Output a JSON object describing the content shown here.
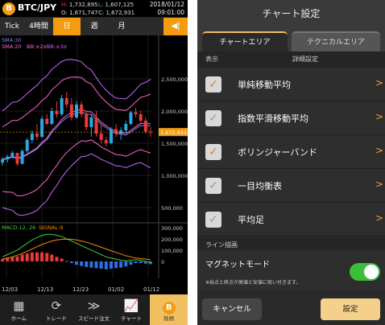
{
  "chart_screen": {
    "pair": "BTC/JPY",
    "ohlc": {
      "H": "1,732,895",
      "L": "1,607,125",
      "O": "1,671,747",
      "C": "1,672,931"
    },
    "date": "2018/01/12",
    "time": "09:01:00",
    "timeframes": [
      "Tick",
      "4時間",
      "日",
      "週",
      "月"
    ],
    "active_timeframe": "日",
    "price_ticks": [
      "2,500,000",
      "2,000,000",
      "1,500,000",
      "1,000,000",
      "500,000"
    ],
    "current_price": "1,672,931",
    "macd_ticks": [
      "300,000",
      "200,000",
      "100,000",
      "0"
    ],
    "date_ticks": [
      "12/03",
      "12/13",
      "12/23",
      "01/02",
      "01/12"
    ],
    "indicator_labels": {
      "sma": "SMA:30",
      "sma_bb": "SMA:20",
      "bb2": "BB:±2σ",
      "bb3": "BB:±3σ",
      "macd": "MACD:12, 26",
      "signal": "SIGNAL:9"
    },
    "nav": [
      {
        "label": "ホーム",
        "icon": "grid-icon"
      },
      {
        "label": "トレード",
        "icon": "refresh-icon"
      },
      {
        "label": "スピード注文",
        "icon": "fast-forward-icon"
      },
      {
        "label": "チャート",
        "icon": "chart-icon"
      },
      {
        "label": "銘柄",
        "icon": "bitcoin-icon"
      }
    ],
    "colors": {
      "up": "#29a9e0",
      "down": "#e83a3a",
      "accent": "#f39c12"
    }
  },
  "chart_data": {
    "type": "candlestick",
    "ylim": [
      300000,
      2900000
    ],
    "candles": [
      [
        1200000,
        1280000,
        1150000,
        1250000
      ],
      [
        1250000,
        1320000,
        1200000,
        1290000
      ],
      [
        1290000,
        1380000,
        1260000,
        1350000
      ],
      [
        1350000,
        1340000,
        1150000,
        1180000
      ],
      [
        1180000,
        1400000,
        1170000,
        1380000
      ],
      [
        1380000,
        1580000,
        1350000,
        1550000
      ],
      [
        1550000,
        1700000,
        1500000,
        1650000
      ],
      [
        1650000,
        1800000,
        1550000,
        1600000
      ],
      [
        1600000,
        1920000,
        1580000,
        1880000
      ],
      [
        1880000,
        1950000,
        1780000,
        1800000
      ],
      [
        1800000,
        2050000,
        1780000,
        2000000
      ],
      [
        2000000,
        2150000,
        1900000,
        1950000
      ],
      [
        1950000,
        2250000,
        1920000,
        2200000
      ],
      [
        2200000,
        2300000,
        2050000,
        2100000
      ],
      [
        2100000,
        2200000,
        1850000,
        1900000
      ],
      [
        1900000,
        2150000,
        1880000,
        2100000
      ],
      [
        2100000,
        2150000,
        1900000,
        1950000
      ],
      [
        1950000,
        2000000,
        1700000,
        1750000
      ],
      [
        1750000,
        1950000,
        1600000,
        1900000
      ],
      [
        1900000,
        2000000,
        1600000,
        1650000
      ],
      [
        1650000,
        1800000,
        1500000,
        1550000
      ],
      [
        1550000,
        1600000,
        1450000,
        1500000
      ],
      [
        1500000,
        1750000,
        1480000,
        1720000
      ],
      [
        1720000,
        1800000,
        1600000,
        1650000
      ],
      [
        1650000,
        1750000,
        1550000,
        1700000
      ],
      [
        1700000,
        1850000,
        1650000,
        1800000
      ],
      [
        1800000,
        2000000,
        1780000,
        1980000
      ],
      [
        1980000,
        2050000,
        1900000,
        1950000
      ],
      [
        1950000,
        2000000,
        1800000,
        1850000
      ],
      [
        1850000,
        1900000,
        1650000,
        1680000
      ],
      [
        1680000,
        1750000,
        1600000,
        1672931
      ]
    ],
    "macd": [
      40000,
      60000,
      80000,
      100000,
      130000,
      160000,
      190000,
      210000,
      230000,
      240000,
      240000,
      230000,
      220000,
      200000,
      180000,
      160000,
      140000,
      120000,
      100000,
      80000,
      60000,
      40000,
      30000,
      20000,
      10000,
      5000,
      10000,
      15000,
      10000,
      0,
      -10000
    ],
    "signal": [
      20000,
      30000,
      40000,
      55000,
      70000,
      90000,
      110000,
      130000,
      150000,
      165000,
      180000,
      190000,
      195000,
      197000,
      195000,
      190000,
      180000,
      170000,
      155000,
      140000,
      125000,
      110000,
      95000,
      80000,
      65000,
      50000,
      40000,
      30000,
      25000,
      20000,
      15000
    ],
    "macd_ylim": [
      -150000,
      320000
    ]
  },
  "settings_screen": {
    "title": "チャート設定",
    "tabs": [
      "チャートエリア",
      "テクニカルエリア"
    ],
    "col_show": "表示",
    "col_detail": "詳細設定",
    "rows": [
      {
        "label": "単純移動平均",
        "checked": true
      },
      {
        "label": "指数平滑移動平均",
        "checked": false
      },
      {
        "label": "ボリンジャーバンド",
        "checked": true
      },
      {
        "label": "一目均衡表",
        "checked": false
      },
      {
        "label": "平均足",
        "checked": false
      }
    ],
    "line_section": "ライン描画",
    "magnet_label": "マグネットモード",
    "magnet_note": "※始点と終点が高値と安値に吸い付きます。",
    "magnet_on": true,
    "cancel": "キャンセル",
    "ok": "設定"
  }
}
